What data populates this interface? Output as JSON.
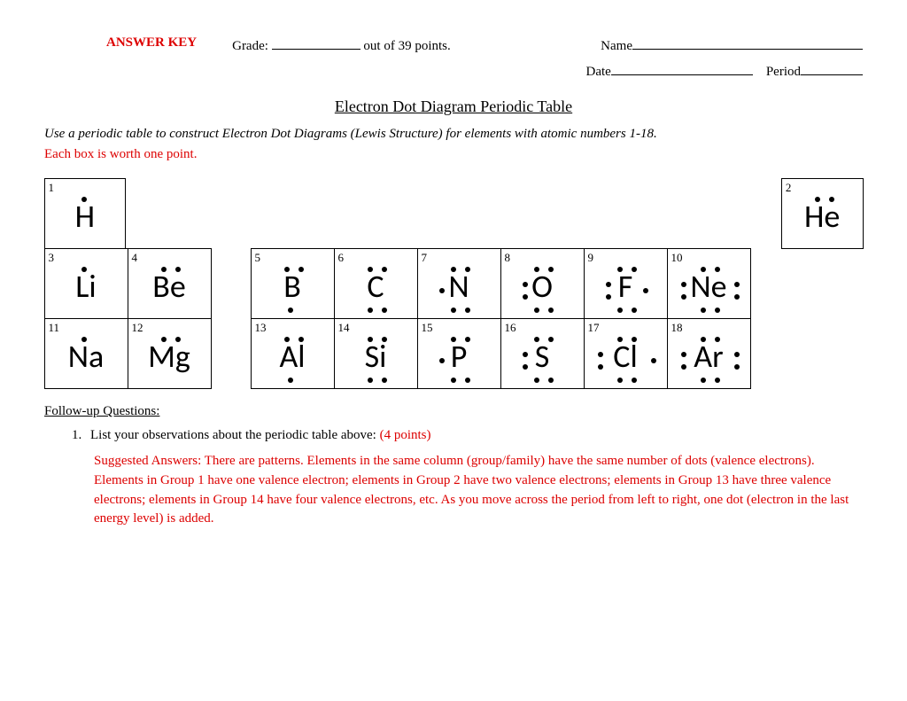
{
  "header": {
    "answer_key": "ANSWER KEY",
    "grade_label": "Grade:",
    "grade_suffix": "out of 39 points.",
    "name_label": "Name",
    "date_label": "Date",
    "period_label": "Period"
  },
  "title": "Electron Dot Diagram Periodic Table",
  "instructions": "Use a periodic table to construct Electron Dot Diagrams (Lewis Structure) for elements with atomic numbers 1-18.",
  "points_note": "Each box is worth one point.",
  "elements": {
    "1": {
      "symbol": "H",
      "valence": 1
    },
    "2": {
      "symbol": "He",
      "valence": 2
    },
    "3": {
      "symbol": "Li",
      "valence": 1
    },
    "4": {
      "symbol": "Be",
      "valence": 2
    },
    "5": {
      "symbol": "B",
      "valence": 3
    },
    "6": {
      "symbol": "C",
      "valence": 4
    },
    "7": {
      "symbol": "N",
      "valence": 5
    },
    "8": {
      "symbol": "O",
      "valence": 6
    },
    "9": {
      "symbol": "F",
      "valence": 7
    },
    "10": {
      "symbol": "Ne",
      "valence": 8
    },
    "11": {
      "symbol": "Na",
      "valence": 1
    },
    "12": {
      "symbol": "Mg",
      "valence": 2
    },
    "13": {
      "symbol": "Al",
      "valence": 3
    },
    "14": {
      "symbol": "Si",
      "valence": 4
    },
    "15": {
      "symbol": "P",
      "valence": 5
    },
    "16": {
      "symbol": "S",
      "valence": 6
    },
    "17": {
      "symbol": "Cl",
      "valence": 7
    },
    "18": {
      "symbol": "Ar",
      "valence": 8
    }
  },
  "followup_heading": "Follow-up Questions:",
  "question1": {
    "text": "List your observations about the periodic table above:",
    "points": "(4 points)"
  },
  "suggested_answer": "Suggested Answers:  There are patterns.  Elements in the same column (group/family) have the same number of dots (valence electrons).  Elements in Group 1 have one valence electron; elements in Group 2 have two valence electrons; elements in Group 13 have three valence electrons; elements in Group 14 have four valence electrons, etc.  As you move across the period from left to right, one dot (electron in the last energy level) is added."
}
